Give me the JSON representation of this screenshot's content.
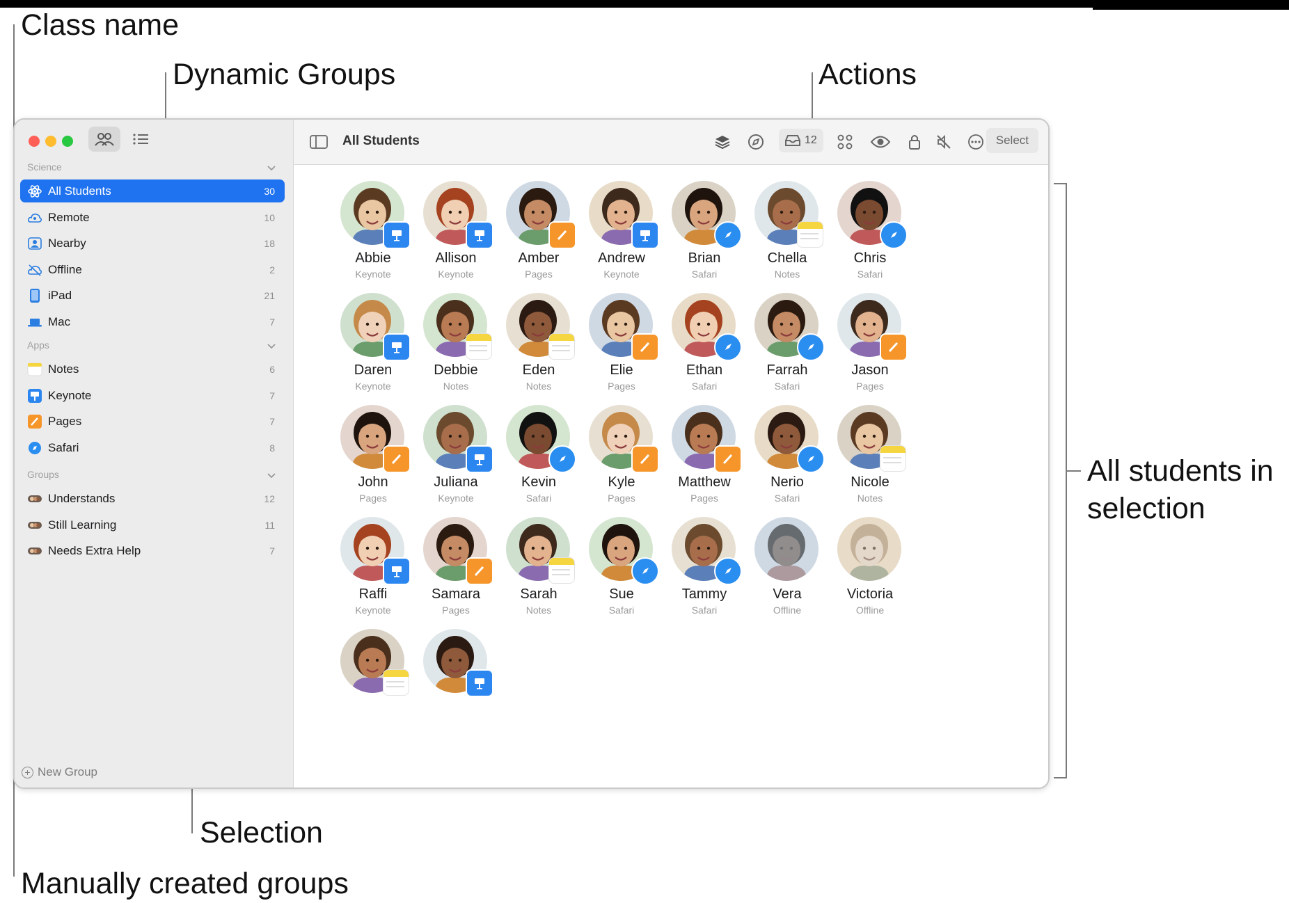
{
  "callouts": {
    "class_name": "Class name",
    "dynamic_groups": "Dynamic Groups",
    "actions": "Actions",
    "all_students": "All students in\nselection",
    "selection": "Selection",
    "manual_groups": "Manually created groups"
  },
  "colors": {
    "accent": "#1f73f0",
    "keynote": "#2c86f0",
    "pages": "#f6952a",
    "safari": "#2a8df0",
    "notes": "#f5d540"
  },
  "sidebar": {
    "sections": [
      {
        "label": "Science",
        "items": [
          {
            "label": "All Students",
            "count": "30",
            "icon": "atom-icon",
            "selected": true
          },
          {
            "label": "Remote",
            "count": "10",
            "icon": "cloud-person-icon"
          },
          {
            "label": "Nearby",
            "count": "18",
            "icon": "person-square-icon"
          },
          {
            "label": "Offline",
            "count": "2",
            "icon": "cloud-slash-icon"
          },
          {
            "label": "iPad",
            "count": "21",
            "icon": "ipad-icon"
          },
          {
            "label": "Mac",
            "count": "7",
            "icon": "laptop-icon"
          }
        ]
      },
      {
        "label": "Apps",
        "items": [
          {
            "label": "Notes",
            "count": "6",
            "icon": "notes-app-icon"
          },
          {
            "label": "Keynote",
            "count": "7",
            "icon": "keynote-app-icon"
          },
          {
            "label": "Pages",
            "count": "7",
            "icon": "pages-app-icon"
          },
          {
            "label": "Safari",
            "count": "8",
            "icon": "safari-app-icon"
          }
        ]
      },
      {
        "label": "Groups",
        "items": [
          {
            "label": "Understands",
            "count": "12",
            "icon": "group-icon"
          },
          {
            "label": "Still Learning",
            "count": "11",
            "icon": "group-icon"
          },
          {
            "label": "Needs Extra Help",
            "count": "7",
            "icon": "group-icon"
          }
        ]
      }
    ],
    "new_group": "New Group"
  },
  "toolbar": {
    "title": "All Students",
    "inbox_count": "12",
    "select_label": "Select"
  },
  "students": [
    {
      "name": "Abbie",
      "app": "Keynote"
    },
    {
      "name": "Allison",
      "app": "Keynote"
    },
    {
      "name": "Amber",
      "app": "Pages"
    },
    {
      "name": "Andrew",
      "app": "Keynote"
    },
    {
      "name": "Brian",
      "app": "Safari"
    },
    {
      "name": "Chella",
      "app": "Notes"
    },
    {
      "name": "Chris",
      "app": "Safari"
    },
    {
      "name": "Daren",
      "app": "Keynote"
    },
    {
      "name": "Debbie",
      "app": "Notes"
    },
    {
      "name": "Eden",
      "app": "Notes"
    },
    {
      "name": "Elie",
      "app": "Pages"
    },
    {
      "name": "Ethan",
      "app": "Safari"
    },
    {
      "name": "Farrah",
      "app": "Safari"
    },
    {
      "name": "Jason",
      "app": "Pages"
    },
    {
      "name": "John",
      "app": "Pages"
    },
    {
      "name": "Juliana",
      "app": "Keynote"
    },
    {
      "name": "Kevin",
      "app": "Safari"
    },
    {
      "name": "Kyle",
      "app": "Pages"
    },
    {
      "name": "Matthew",
      "app": "Pages"
    },
    {
      "name": "Nerio",
      "app": "Safari"
    },
    {
      "name": "Nicole",
      "app": "Notes"
    },
    {
      "name": "Raffi",
      "app": "Keynote"
    },
    {
      "name": "Samara",
      "app": "Pages"
    },
    {
      "name": "Sarah",
      "app": "Notes"
    },
    {
      "name": "Sue",
      "app": "Safari"
    },
    {
      "name": "Tammy",
      "app": "Safari"
    },
    {
      "name": "Vera",
      "app": "Offline"
    },
    {
      "name": "Victoria",
      "app": "Offline"
    },
    {
      "name": "",
      "app": "Notes"
    },
    {
      "name": "",
      "app": "Keynote"
    }
  ]
}
